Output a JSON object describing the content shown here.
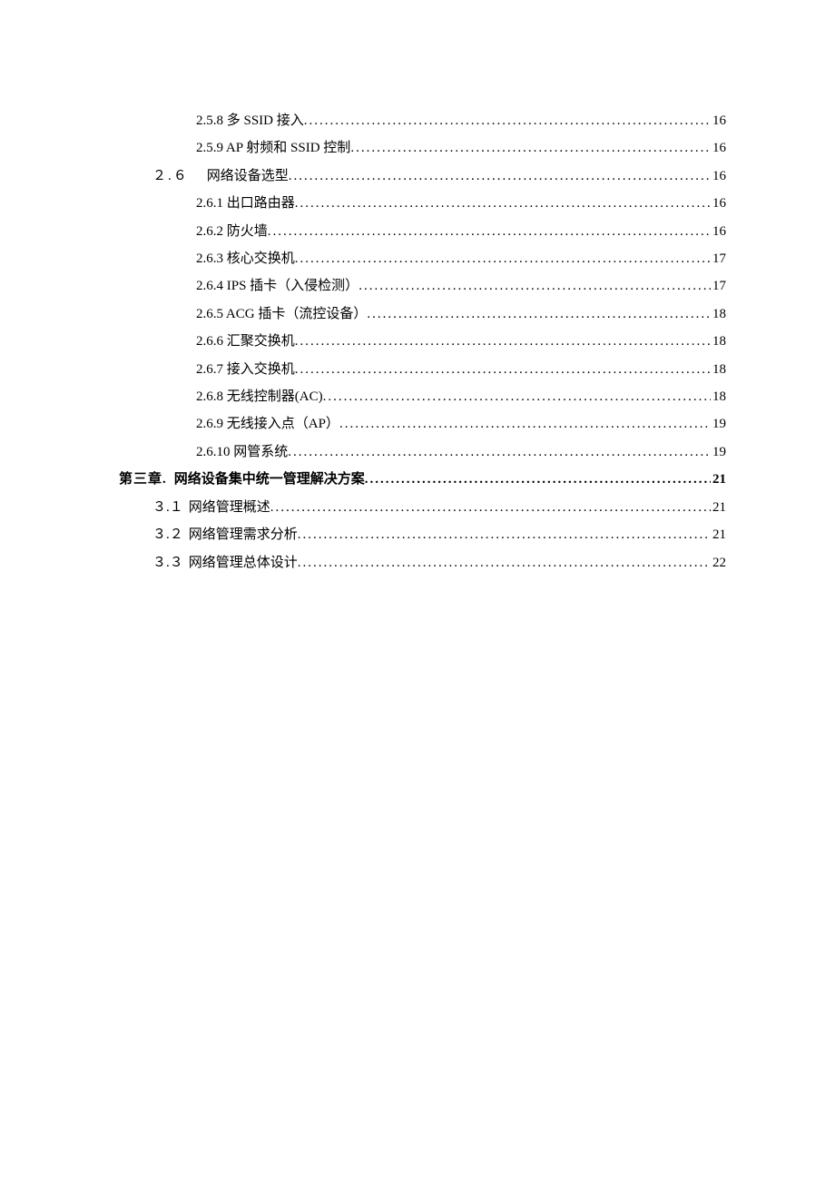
{
  "toc": {
    "r0": {
      "label": "2.5.8 多 SSID 接入",
      "page": "16"
    },
    "r1": {
      "label": "2.5.9 AP 射频和 SSID 控制",
      "page": "16"
    },
    "r2": {
      "prefix": "２.６",
      "label": "网络设备选型",
      "page": "16"
    },
    "r3": {
      "label": "2.6.1 出口路由器",
      "page": "16"
    },
    "r4": {
      "label": "2.6.2 防火墙",
      "page": "16"
    },
    "r5": {
      "label": "2.6.3 核心交换机",
      "page": "17"
    },
    "r6": {
      "label": "2.6.4 IPS 插卡（入侵检测）",
      "page": "17"
    },
    "r7": {
      "label": "2.6.5 ACG 插卡（流控设备）",
      "page": "18"
    },
    "r8": {
      "label": "2.6.6 汇聚交换机",
      "page": "18"
    },
    "r9": {
      "label": "2.6.7 接入交换机",
      "page": "18"
    },
    "r10": {
      "label": "2.6.8 无线控制器(AC)",
      "page": "18"
    },
    "r11": {
      "label": "2.6.9 无线接入点（AP）",
      "page": "19"
    },
    "r12": {
      "label": "2.6.10 网管系统",
      "page": "19"
    },
    "r13": {
      "prefix": "第三章.",
      "label": "网络设备集中统一管理解决方案",
      "page": "21"
    },
    "r14": {
      "prefix": "３.１",
      "label": "网络管理概述",
      "page": "21"
    },
    "r15": {
      "prefix": "３.２",
      "label": "网络管理需求分析",
      "page": "21"
    },
    "r16": {
      "prefix": "３.３",
      "label": "网络管理总体设计",
      "page": "22"
    }
  }
}
